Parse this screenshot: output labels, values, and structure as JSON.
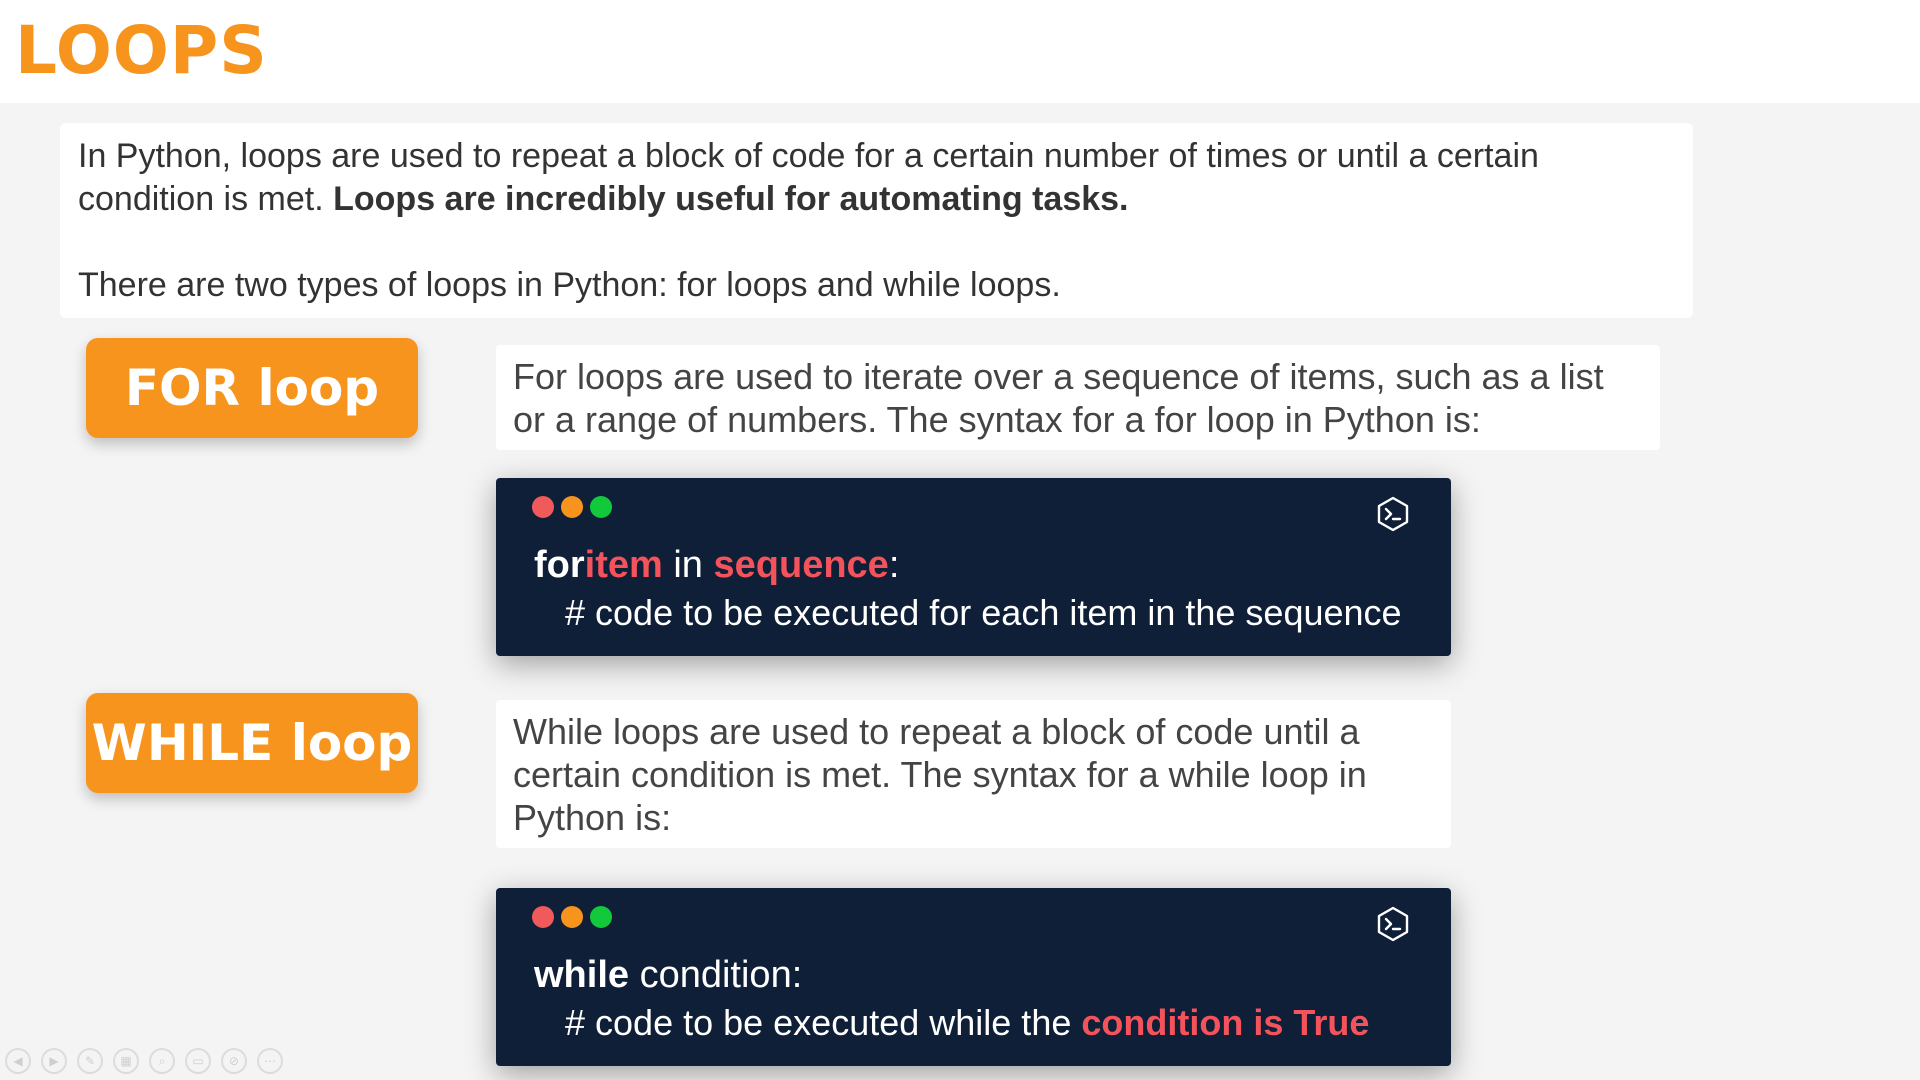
{
  "header": {
    "title": "LOOPS"
  },
  "intro": {
    "p1_text": "In Python, loops are used to repeat a block of code for a certain number of times or until a certain condition is met. ",
    "p1_bold": "Loops are incredibly useful for automating tasks.",
    "p2_text": "There are two types of loops in Python: for loops and while loops."
  },
  "for_section": {
    "badge": "FOR loop",
    "description": "For loops are used to iterate over a sequence of items, such as a list or a range of numbers. The syntax for a for loop in Python is:",
    "code": {
      "kw": "for",
      "var": "item",
      "in_kw": " in ",
      "seq": "sequence",
      "colon": ":",
      "comment": "# code to be executed for each item in the sequence"
    }
  },
  "while_section": {
    "badge": "WHILE loop",
    "description": "While loops are used to repeat a block of code until a certain condition is met. The syntax for a while loop in Python is:",
    "code": {
      "kw": "while",
      "rest": " condition:",
      "comment_prefix": "# code to be executed while the ",
      "comment_highlight": "condition is True"
    }
  },
  "colors": {
    "accent": "#f7941d",
    "code_bg": "#0f1f38",
    "highlight": "#f4535b",
    "dot_red": "#f15a5a",
    "dot_orange": "#f7941d",
    "dot_green": "#12c93c"
  },
  "toolbar": {
    "icons": [
      "prev-slide-icon",
      "next-slide-icon",
      "pen-icon",
      "slides-icon",
      "zoom-icon",
      "subtitles-icon",
      "camera-off-icon",
      "more-icon"
    ]
  }
}
